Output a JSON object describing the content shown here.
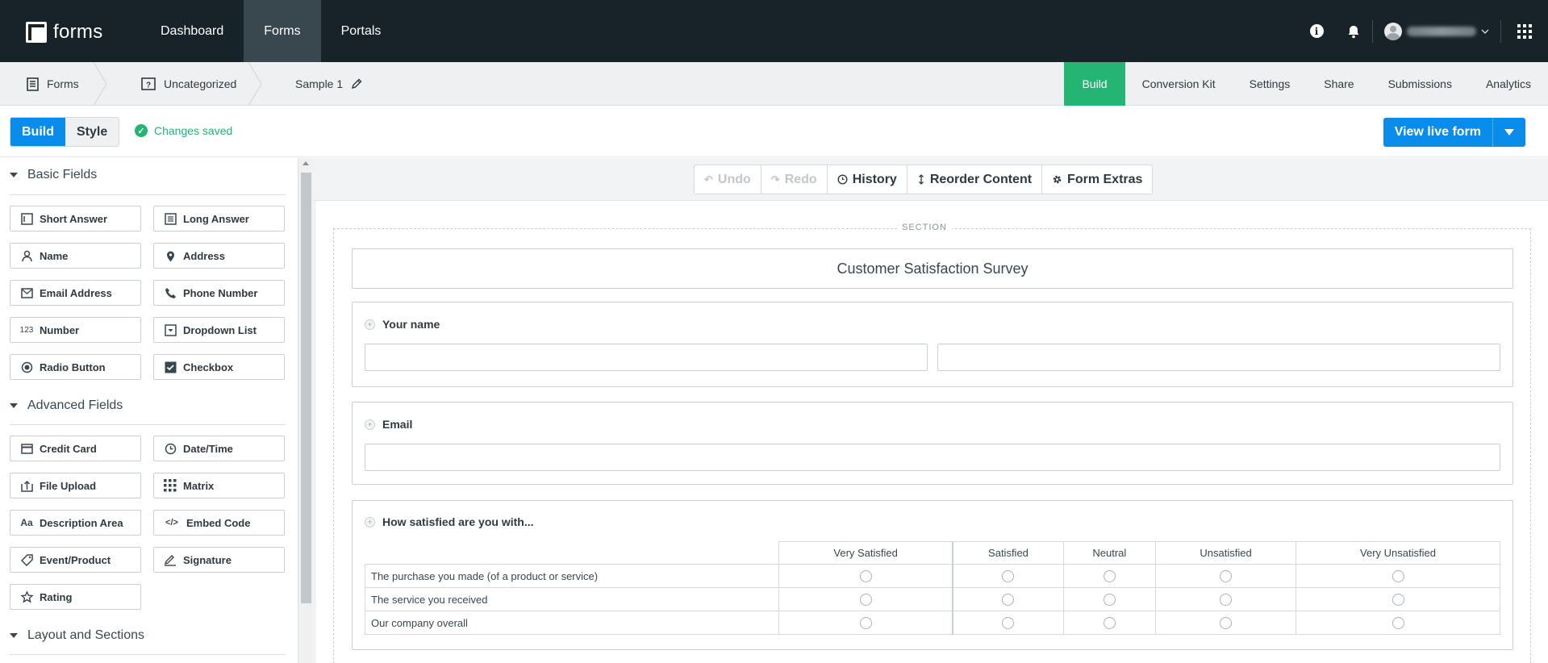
{
  "app": {
    "logo_text": "forms"
  },
  "topnav": [
    {
      "label": "Dashboard"
    },
    {
      "label": "Forms"
    },
    {
      "label": "Portals"
    }
  ],
  "breadcrumb": [
    {
      "label": "Forms",
      "icon": "form-icon"
    },
    {
      "label": "Uncategorized",
      "icon": "folder-question-icon"
    },
    {
      "label": "Sample 1",
      "icon": "pencil-icon"
    }
  ],
  "build_tabs": [
    {
      "label": "Build",
      "active": true
    },
    {
      "label": "Conversion Kit"
    },
    {
      "label": "Settings"
    },
    {
      "label": "Share"
    },
    {
      "label": "Submissions"
    },
    {
      "label": "Analytics"
    }
  ],
  "mode": {
    "build": "Build",
    "style": "Style"
  },
  "status": {
    "saved": "Changes saved"
  },
  "live_button": {
    "label": "View live form"
  },
  "panel": {
    "basic": {
      "title": "Basic Fields",
      "fields": [
        {
          "label": "Short Answer",
          "icon": "short-answer-icon"
        },
        {
          "label": "Long Answer",
          "icon": "long-answer-icon"
        },
        {
          "label": "Name",
          "icon": "person-icon"
        },
        {
          "label": "Address",
          "icon": "map-pin-icon"
        },
        {
          "label": "Email Address",
          "icon": "envelope-icon"
        },
        {
          "label": "Phone Number",
          "icon": "phone-icon"
        },
        {
          "label": "Number",
          "icon": "number-icon",
          "glyph": "123"
        },
        {
          "label": "Dropdown List",
          "icon": "dropdown-icon"
        },
        {
          "label": "Radio Button",
          "icon": "radio-icon"
        },
        {
          "label": "Checkbox",
          "icon": "checkbox-icon"
        }
      ]
    },
    "advanced": {
      "title": "Advanced Fields",
      "fields": [
        {
          "label": "Credit Card",
          "icon": "credit-card-icon"
        },
        {
          "label": "Date/Time",
          "icon": "clock-icon"
        },
        {
          "label": "File Upload",
          "icon": "upload-icon"
        },
        {
          "label": "Matrix",
          "icon": "matrix-icon"
        },
        {
          "label": "Description Area",
          "icon": "text-icon",
          "glyph": "Aa"
        },
        {
          "label": "Embed Code",
          "icon": "code-icon",
          "glyph": "</>"
        },
        {
          "label": "Event/Product",
          "icon": "tag-icon"
        },
        {
          "label": "Signature",
          "icon": "signature-icon"
        },
        {
          "label": "Rating",
          "icon": "star-icon"
        }
      ]
    },
    "layout": {
      "title": "Layout and Sections"
    }
  },
  "canvas_toolbar": {
    "undo": "Undo",
    "redo": "Redo",
    "history": "History",
    "reorder": "Reorder Content",
    "extras": "Form Extras"
  },
  "form": {
    "section_label": "SECTION",
    "title": "Customer Satisfaction Survey",
    "q_name": "Your name",
    "q_email": "Email",
    "q_satisfaction": "How satisfied are you with...",
    "matrix_columns": [
      "Very Satisfied",
      "Satisfied",
      "Neutral",
      "Unsatisfied",
      "Very Unsatisfied"
    ],
    "matrix_rows": [
      "The purchase you made (of a product or service)",
      "The service you received",
      "Our company overall"
    ]
  }
}
